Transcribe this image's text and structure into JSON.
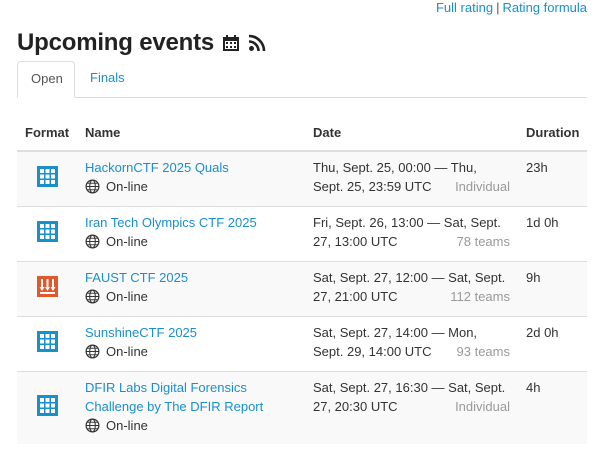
{
  "links": {
    "full_rating": "Full rating",
    "separator": "|",
    "rating_formula": "Rating formula"
  },
  "page": {
    "title": "Upcoming events",
    "calendar_icon": "calendar-icon",
    "rss_icon": "rss-icon"
  },
  "tabs": [
    {
      "label": "Open",
      "active": true
    },
    {
      "label": "Finals",
      "active": false
    }
  ],
  "table": {
    "headers": {
      "format": "Format",
      "name": "Name",
      "date": "Date",
      "duration": "Duration"
    },
    "rows": [
      {
        "format_icon": "jeopardy-icon",
        "format_color": "#1a8fc9",
        "name": "HackornCTF 2025 Quals",
        "location": "On-line",
        "date": "Thu, Sept. 25, 00:00 — Thu, Sept. 25, 23:59 UTC",
        "participants": "Individual",
        "duration": "23h"
      },
      {
        "format_icon": "jeopardy-icon",
        "format_color": "#1a8fc9",
        "name": "Iran Tech Olympics CTF 2025",
        "location": "On-line",
        "date": "Fri, Sept. 26, 13:00 — Sat, Sept. 27, 13:00 UTC",
        "participants": "78 teams",
        "duration": "1d 0h"
      },
      {
        "format_icon": "attack-defense-icon",
        "format_color": "#e0582b",
        "name": "FAUST CTF 2025",
        "location": "On-line",
        "date": "Sat, Sept. 27, 12:00 — Sat, Sept. 27, 21:00 UTC",
        "participants": "112 teams",
        "duration": "9h"
      },
      {
        "format_icon": "jeopardy-icon",
        "format_color": "#1a8fc9",
        "name": "SunshineCTF 2025",
        "location": "On-line",
        "date": "Sat, Sept. 27, 14:00 — Mon, Sept. 29, 14:00 UTC",
        "participants": "93 teams",
        "duration": "2d 0h"
      },
      {
        "format_icon": "jeopardy-icon",
        "format_color": "#1a8fc9",
        "name": "DFIR Labs Digital Forensics Challenge by The DFIR Report",
        "location": "On-line",
        "date": "Sat, Sept. 27, 16:30 — Sat, Sept. 27, 20:30 UTC",
        "participants": "Individual",
        "duration": "4h"
      }
    ]
  }
}
